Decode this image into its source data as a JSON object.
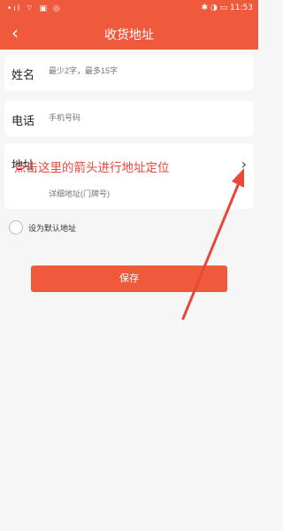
{
  "statusbar": {
    "left": "•ıl ⌔ ▣ ◎",
    "right": "✱ ◑ ▭ 11:53"
  },
  "navbar": {
    "back_icon": "chevron-left-icon",
    "back_glyph": "‹",
    "title": "收货地址"
  },
  "form": {
    "name_label": "姓名",
    "name_placeholder": "最少2字，最多15字",
    "phone_label": "电话",
    "phone_placeholder": "手机号码",
    "address_label": "地址",
    "address_chevron": "›",
    "detail_placeholder": "详细地址(门牌号)"
  },
  "annotation": {
    "text": "点击这里的箭头进行地址定位",
    "color": "#e8473a"
  },
  "default_option": {
    "label": "设为默认地址"
  },
  "save_button": {
    "label": "保存",
    "color": "#f05a3c"
  }
}
